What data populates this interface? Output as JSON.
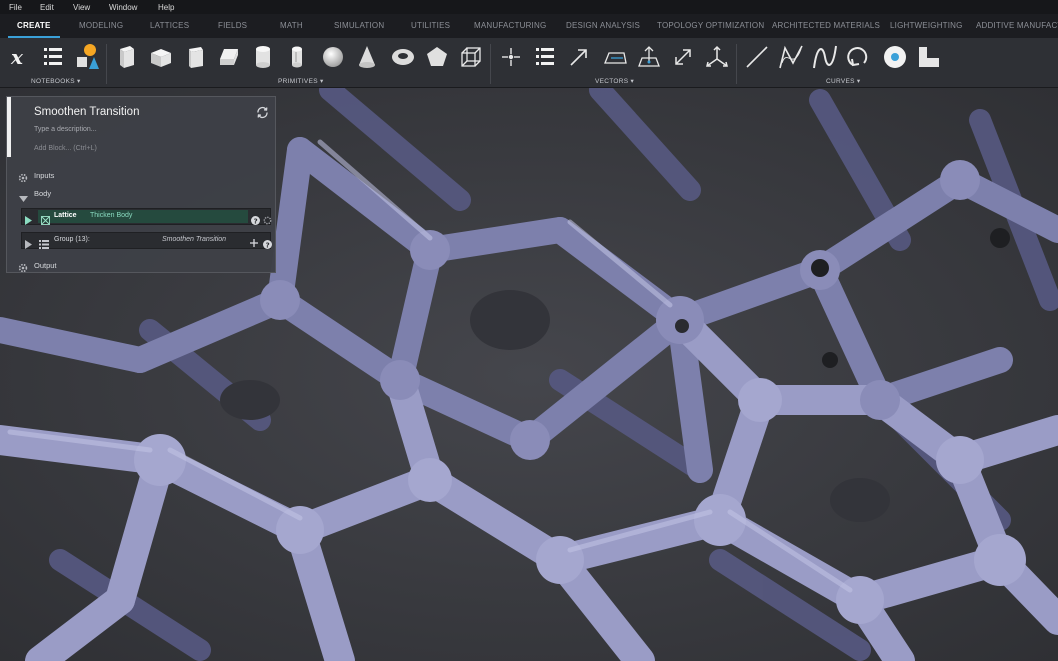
{
  "menu": [
    "File",
    "Edit",
    "View",
    "Window",
    "Help"
  ],
  "tabs": [
    "CREATE",
    "MODELING",
    "LATTICES",
    "FIELDS",
    "MATH",
    "SIMULATION",
    "UTILITIES",
    "MANUFACTURING",
    "DESIGN ANALYSIS",
    "TOPOLOGY OPTIMIZATION",
    "ARCHITECTED MATERIALS",
    "LIGHTWEIGHTING",
    "ADDITIVE MANUFACTU"
  ],
  "active_tab": "CREATE",
  "toolbar": {
    "groups": [
      "NOTEBOOKS ▾",
      "PRIMITIVES ▾",
      "VECTORS ▾",
      "CURVES ▾"
    ],
    "tools": [
      "variable-icon",
      "list-icon",
      "shapes-icon",
      "cube-icon",
      "box-icon",
      "cuboid-icon",
      "prism-icon",
      "cylinder-icon",
      "capsule-icon",
      "sphere-icon",
      "cone-icon",
      "torus-icon",
      "pentagon-icon",
      "wireframe-cube-icon",
      "point-icon",
      "vector-list-icon",
      "vector-arrow-icon",
      "plane-icon",
      "plane-normal-icon",
      "two-point-icon",
      "frame-icon",
      "line-icon",
      "polyline-icon",
      "spline-icon",
      "arc-icon",
      "circle-icon",
      "profile-icon"
    ]
  },
  "panel": {
    "title": "Smoothen Transition",
    "description": "Type a description...",
    "add_block": "Add Block... (Ctrl+L)",
    "inputs_label": "Inputs",
    "body_label": "Body",
    "lattice_type": "Lattice",
    "lattice_value": "Thicken Body",
    "group_label": "Group (13):",
    "group_value": "Smoothen Transition",
    "output_label": "Output"
  },
  "colors": {
    "accent": "#3aa0d8",
    "lattice_fill": "#9a9cc6",
    "lattice_dark": "#4a4c72",
    "viewport_bg": "#3a3b40"
  }
}
